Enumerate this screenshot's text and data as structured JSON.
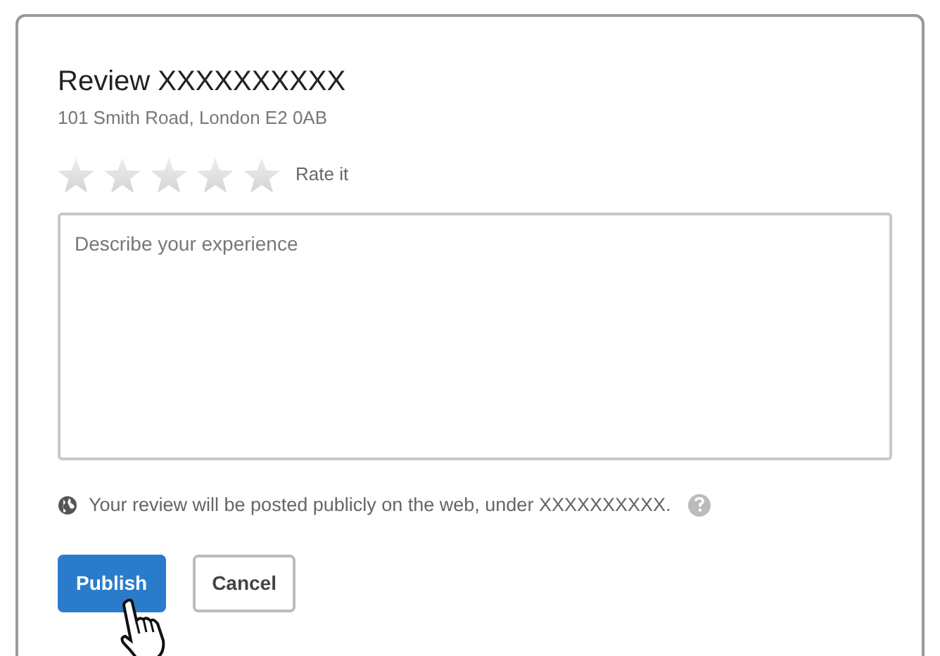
{
  "dialog": {
    "title": "Review XXXXXXXXXX",
    "address": "101 Smith Road, London E2 0AB"
  },
  "rating": {
    "stars": 0,
    "label": "Rate it"
  },
  "review_field": {
    "placeholder": "Describe your experience"
  },
  "notice": {
    "text": "Your review will be posted publicly on the web, under XXXXXXXXXX."
  },
  "buttons": [
    {
      "label": "Publish",
      "kind": "primary"
    },
    {
      "label": "Cancel",
      "kind": "secondary"
    }
  ]
}
